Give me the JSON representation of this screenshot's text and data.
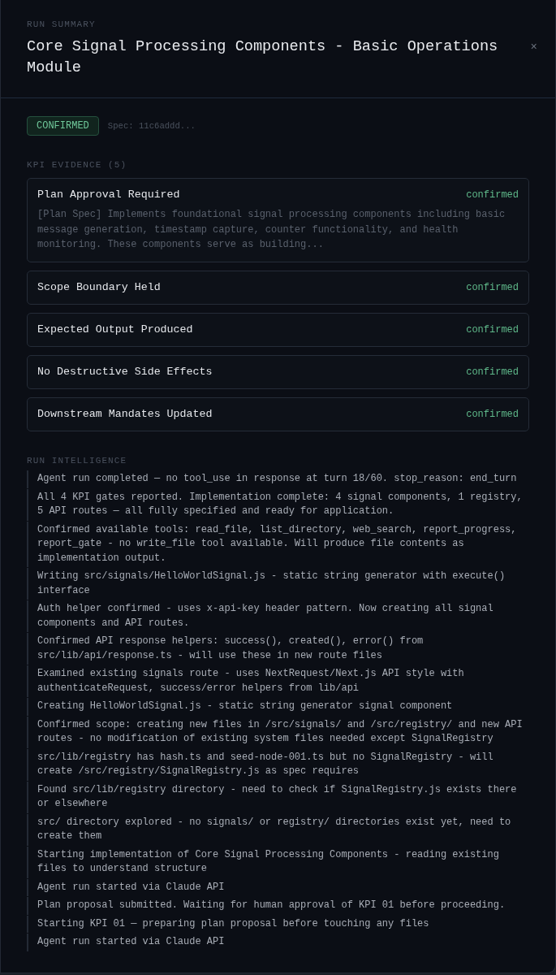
{
  "header": {
    "eyebrow": "RUN SUMMARY",
    "title": "Core Signal Processing Components - Basic Operations Module",
    "close": "×"
  },
  "status": {
    "badge": "CONFIRMED",
    "spec": "Spec: 11c6addd..."
  },
  "kpi_evidence": {
    "heading": "KPI EVIDENCE (5)",
    "items": [
      {
        "title": "Plan Approval Required",
        "status": "confirmed",
        "detail": "[Plan Spec] Implements foundational signal processing components including basic message generation, timestamp capture, counter functionality, and health monitoring. These components serve as building..."
      },
      {
        "title": "Scope Boundary Held",
        "status": "confirmed"
      },
      {
        "title": "Expected Output Produced",
        "status": "confirmed"
      },
      {
        "title": "No Destructive Side Effects",
        "status": "confirmed"
      },
      {
        "title": "Downstream Mandates Updated",
        "status": "confirmed"
      }
    ]
  },
  "run_intelligence": {
    "heading": "RUN INTELLIGENCE",
    "entries": [
      "Agent run completed — no tool_use in response at turn 18/60. stop_reason: end_turn",
      "All 4 KPI gates reported. Implementation complete: 4 signal components, 1 registry, 5 API routes — all fully specified and ready for application.",
      "Confirmed available tools: read_file, list_directory, web_search, report_progress, report_gate - no write_file tool available. Will produce file contents as implementation output.",
      "Writing src/signals/HelloWorldSignal.js - static string generator with execute() interface",
      "Auth helper confirmed - uses x-api-key header pattern. Now creating all signal components and API routes.",
      "Confirmed API response helpers: success(), created(), error() from src/lib/api/response.ts - will use these in new route files",
      "Examined existing signals route - uses NextRequest/Next.js API style with authenticateRequest, success/error helpers from lib/api",
      "Creating HelloWorldSignal.js - static string generator signal component",
      "Confirmed scope: creating new files in /src/signals/ and /src/registry/ and new API routes - no modification of existing system files needed except SignalRegistry",
      "src/lib/registry has hash.ts and seed-node-001.ts but no SignalRegistry - will create /src/registry/SignalRegistry.js as spec requires",
      "Found src/lib/registry directory - need to check if SignalRegistry.js exists there or elsewhere",
      "src/ directory explored - no signals/ or registry/ directories exist yet, need to create them",
      "Starting implementation of Core Signal Processing Components - reading existing files to understand structure",
      "Agent run started via Claude API",
      "Plan proposal submitted. Waiting for human approval of KPI 01 before proceeding.",
      "Starting KPI 01 — preparing plan proposal before touching any files",
      "Agent run started via Claude API"
    ]
  }
}
